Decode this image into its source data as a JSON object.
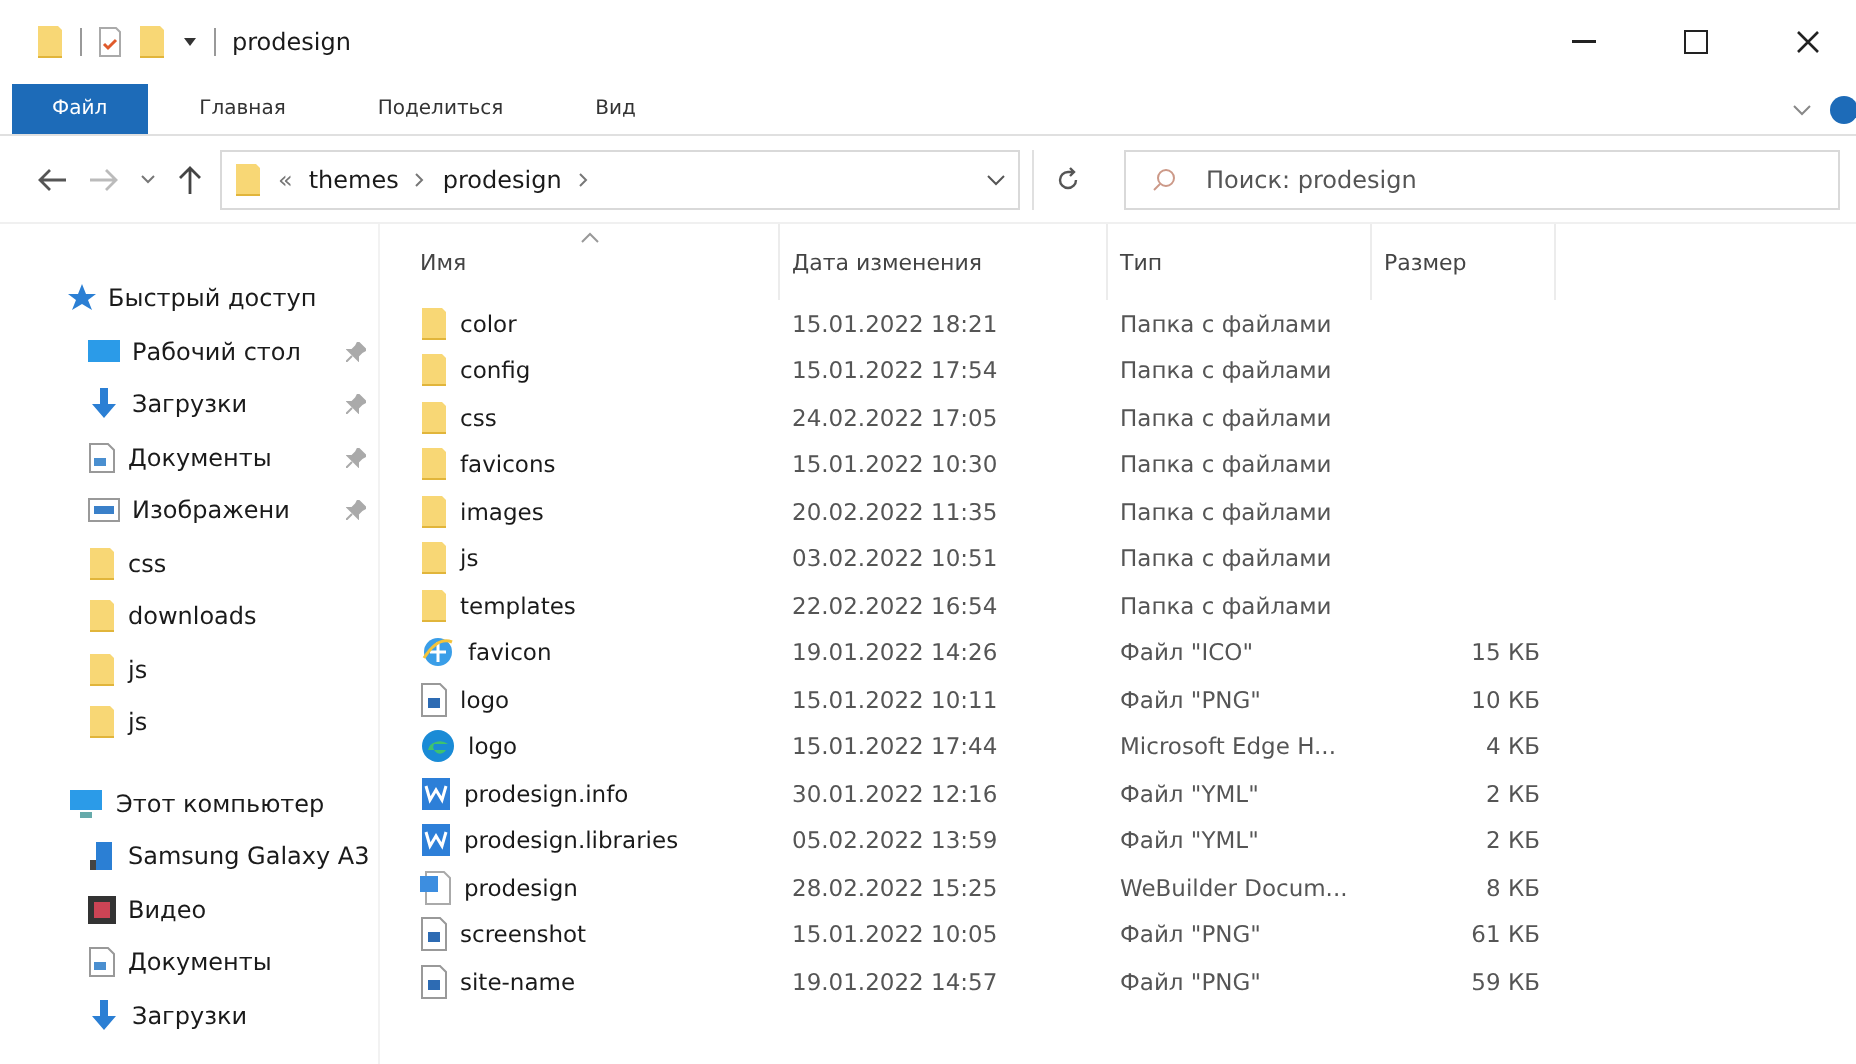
{
  "window": {
    "title": "prodesign"
  },
  "ribbon_tabs": [
    {
      "label": "Файл",
      "selected": true
    },
    {
      "label": "Главная",
      "selected": false
    },
    {
      "label": "Поделиться",
      "selected": false
    },
    {
      "label": "Вид",
      "selected": false
    }
  ],
  "address": {
    "overflow": "«",
    "segments": [
      "themes",
      "prodesign"
    ]
  },
  "search": {
    "placeholder": "Поиск: prodesign"
  },
  "sidebar": {
    "groups": [
      {
        "label": "Быстрый доступ",
        "kind": "star",
        "items": [
          {
            "label": "Рабочий стол",
            "kind": "desktop",
            "pinned": true
          },
          {
            "label": "Загрузки",
            "kind": "download",
            "pinned": true
          },
          {
            "label": "Документы",
            "kind": "document",
            "pinned": true
          },
          {
            "label": "Изображени",
            "kind": "image",
            "pinned": true
          },
          {
            "label": "css",
            "kind": "folder",
            "pinned": false
          },
          {
            "label": "downloads",
            "kind": "folder",
            "pinned": false
          },
          {
            "label": "js",
            "kind": "folder",
            "pinned": false
          },
          {
            "label": "js",
            "kind": "folder",
            "pinned": false
          }
        ]
      },
      {
        "label": "Этот компьютер",
        "kind": "computer",
        "items": [
          {
            "label": "Samsung Galaxy A3",
            "kind": "phone",
            "pinned": false
          },
          {
            "label": "Видео",
            "kind": "video",
            "pinned": false
          },
          {
            "label": "Документы",
            "kind": "document",
            "pinned": false
          },
          {
            "label": "Загрузки",
            "kind": "download",
            "pinned": false
          }
        ]
      }
    ]
  },
  "table": {
    "columns": [
      "Имя",
      "Дата изменения",
      "Тип",
      "Размер"
    ],
    "rows": [
      {
        "kind": "folder",
        "name": "color",
        "date": "15.01.2022 18:21",
        "type": "Папка с файлами"
      },
      {
        "kind": "folder",
        "name": "config",
        "date": "15.01.2022 17:54",
        "type": "Папка с файлами"
      },
      {
        "kind": "folder",
        "name": "css",
        "date": "24.02.2022 17:05",
        "type": "Папка с файлами"
      },
      {
        "kind": "folder",
        "name": "favicons",
        "date": "15.01.2022 10:30",
        "type": "Папка с файлами"
      },
      {
        "kind": "folder",
        "name": "images",
        "date": "20.02.2022 11:35",
        "type": "Папка с файлами"
      },
      {
        "kind": "folder",
        "name": "js",
        "date": "03.02.2022 10:51",
        "type": "Папка с файлами"
      },
      {
        "kind": "folder",
        "name": "templates",
        "date": "22.02.2022 16:54",
        "type": "Папка с файлами"
      },
      {
        "kind": "ie",
        "name": "favicon",
        "date": "19.01.2022 14:26",
        "type": "Файл \"ICO\"",
        "size": "15 КБ"
      },
      {
        "kind": "image",
        "name": "logo",
        "date": "15.01.2022 10:11",
        "type": "Файл \"PNG\"",
        "size": "10 КБ"
      },
      {
        "kind": "edge",
        "name": "logo",
        "date": "15.01.2022 17:44",
        "type": "Microsoft Edge H...",
        "size": "4 КБ"
      },
      {
        "kind": "webbuilder",
        "name": "prodesign.info",
        "date": "30.01.2022 12:16",
        "type": "Файл \"YML\"",
        "size": "2 КБ"
      },
      {
        "kind": "webbuilder",
        "name": "prodesign.libraries",
        "date": "05.02.2022 13:59",
        "type": "Файл \"YML\"",
        "size": "2 КБ"
      },
      {
        "kind": "wbdoc",
        "name": "prodesign",
        "date": "28.02.2022 15:25",
        "type": "WeBuilder Docum...",
        "size": "8 КБ"
      },
      {
        "kind": "image",
        "name": "screenshot",
        "date": "15.01.2022 10:05",
        "type": "Файл \"PNG\"",
        "size": "61 КБ"
      },
      {
        "kind": "image",
        "name": "site-name",
        "date": "19.01.2022 14:57",
        "type": "Файл \"PNG\"",
        "size": "59 КБ"
      }
    ]
  }
}
